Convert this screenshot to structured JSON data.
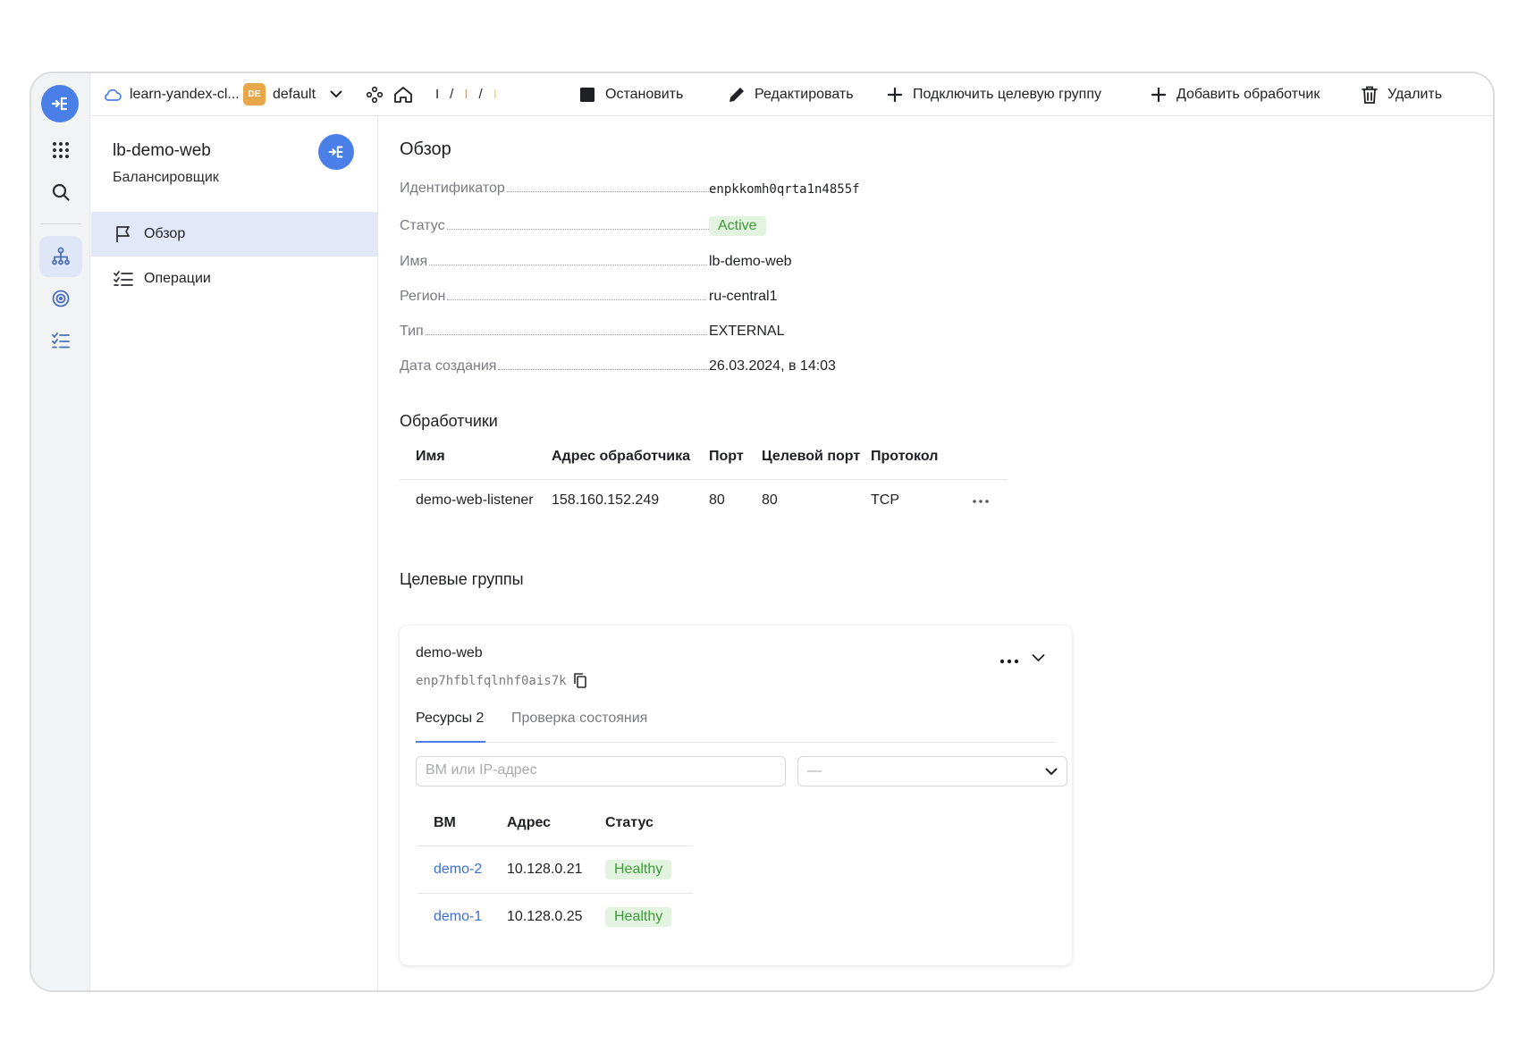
{
  "topbar": {
    "cloud_name": "learn-yandex-cl...",
    "folder_badge": "DE",
    "folder_name": "default",
    "crumb_seps": [
      "I",
      "/",
      "I",
      "/",
      "I"
    ],
    "actions": {
      "stop": "Остановить",
      "edit": "Редактировать",
      "attach_group": "Подключить целевую группу",
      "add_listener": "Добавить обработчик",
      "delete": "Удалить"
    }
  },
  "sidebar": {
    "title": "lb-demo-web",
    "subtitle": "Балансировщик",
    "items": [
      {
        "label": "Обзор",
        "icon": "flag-icon",
        "active": true
      },
      {
        "label": "Операции",
        "icon": "list-check-icon",
        "active": false
      }
    ]
  },
  "overview": {
    "heading": "Обзор",
    "props": [
      {
        "key": "Идентификатор",
        "value": "enpkkomh0qrta1n4855f"
      },
      {
        "key": "Статус",
        "value": "Active"
      },
      {
        "key": "Имя",
        "value": "lb-demo-web"
      },
      {
        "key": "Регион",
        "value": "ru-central1"
      },
      {
        "key": "Тип",
        "value": "EXTERNAL"
      },
      {
        "key": "Дата создания",
        "value": "26.03.2024, в 14:03"
      }
    ]
  },
  "listeners": {
    "heading": "Обработчики",
    "columns": [
      "Имя",
      "Адрес обработчика",
      "Порт",
      "Целевой порт",
      "Протокол"
    ],
    "rows": [
      {
        "name": "demo-web-listener",
        "address": "158.160.152.249",
        "port": "80",
        "target_port": "80",
        "protocol": "TCP"
      }
    ]
  },
  "target_groups": {
    "heading": "Целевые группы",
    "group": {
      "name": "demo-web",
      "id": "enp7hfblfqlnhf0ais7k",
      "tabs": [
        "Ресурсы 2",
        "Проверка состояния"
      ],
      "search_placeholder": "ВМ или IP-адрес",
      "filter_value": "—",
      "columns": [
        "ВМ",
        "Адрес",
        "Статус"
      ],
      "rows": [
        {
          "vm": "demo-2",
          "address": "10.128.0.21",
          "status": "Healthy"
        },
        {
          "vm": "demo-1",
          "address": "10.128.0.25",
          "status": "Healthy"
        }
      ]
    }
  },
  "colors": {
    "accent": "#4a7fe8",
    "success_bg": "#e2f3df",
    "success_text": "#3d9a3a",
    "link": "#3d6fd6"
  }
}
